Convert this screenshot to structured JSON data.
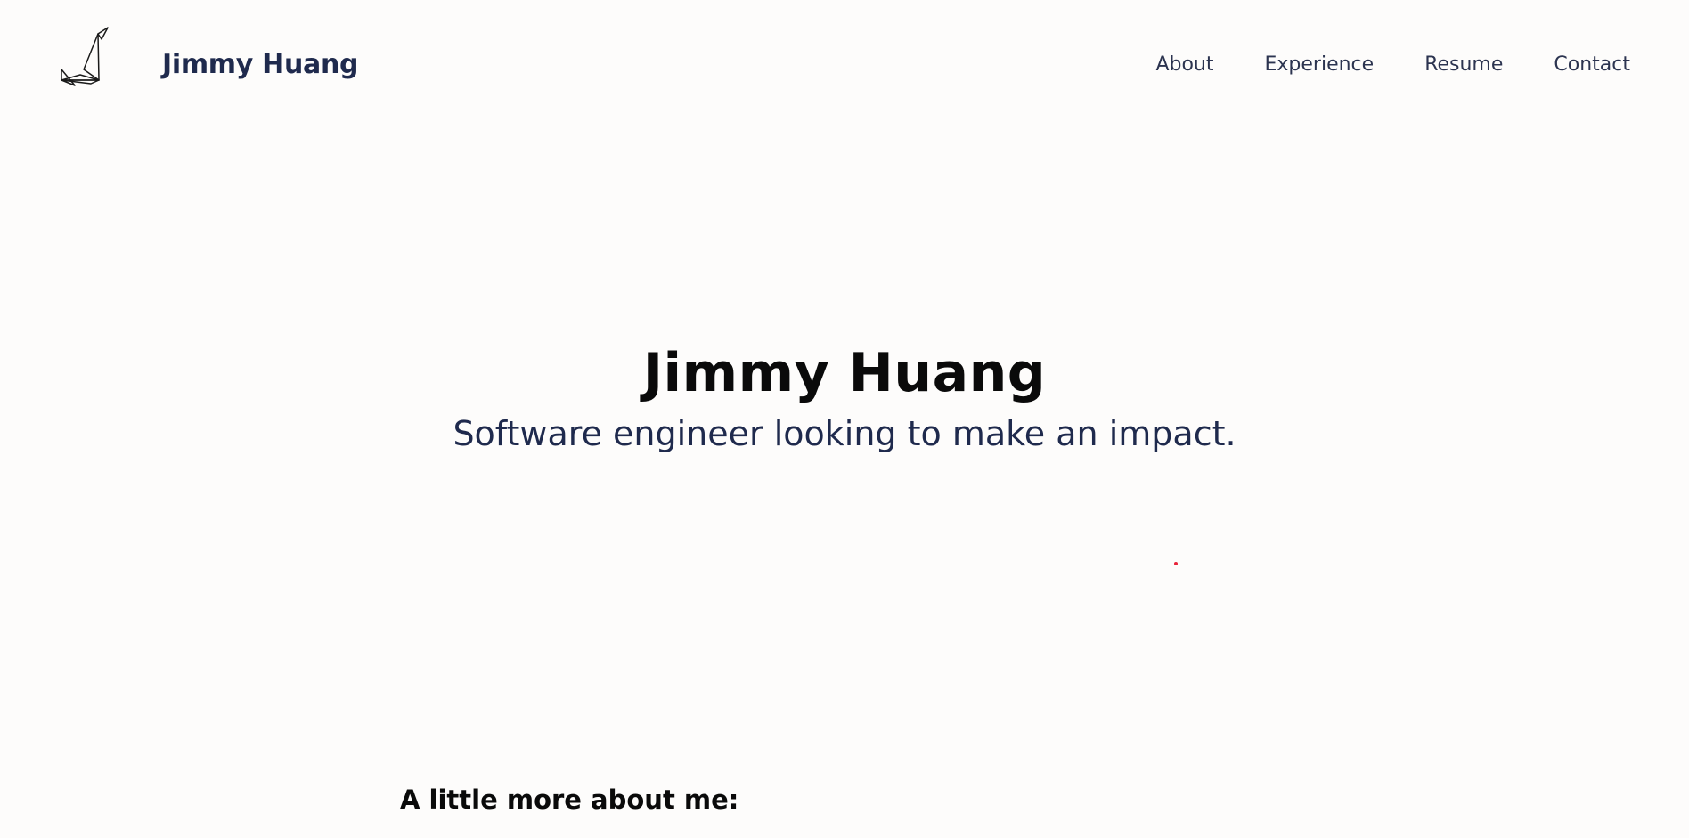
{
  "header": {
    "logo_icon": "origami-crane-icon",
    "brand": "Jimmy Huang",
    "nav": [
      {
        "label": "About"
      },
      {
        "label": "Experience"
      },
      {
        "label": "Resume"
      },
      {
        "label": "Contact"
      }
    ]
  },
  "hero": {
    "title": "Jimmy Huang",
    "subtitle": "Software engineer looking to make an impact."
  },
  "about": {
    "heading": "A little more about me:"
  },
  "colors": {
    "background": "#fdfcfb",
    "brand_text": "#1f2a4d",
    "heading_text": "#0a0a0a",
    "accent_dot": "#e8243a"
  }
}
